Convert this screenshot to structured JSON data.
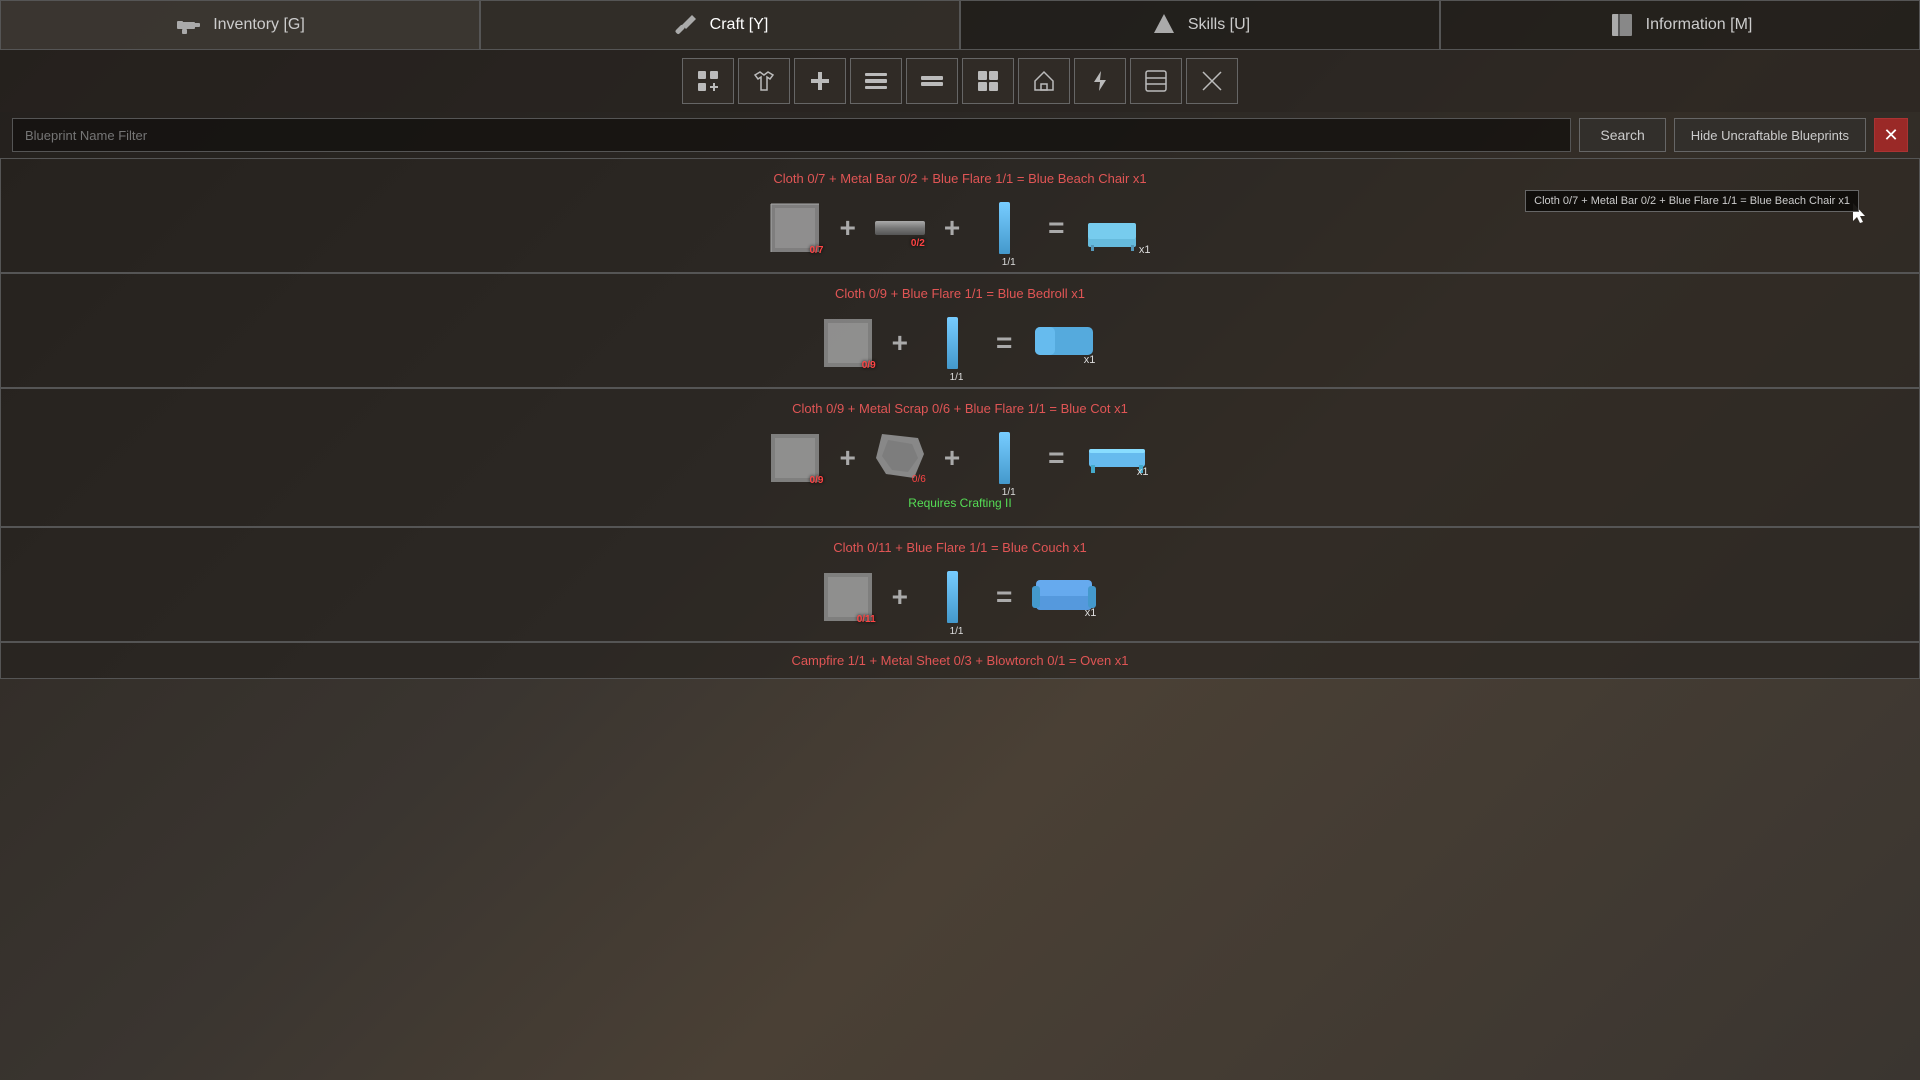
{
  "nav": {
    "items": [
      {
        "id": "inventory",
        "label": "Inventory [G]",
        "icon": "gun"
      },
      {
        "id": "craft",
        "label": "Craft [Y]",
        "icon": "wrench",
        "active": true
      },
      {
        "id": "skills",
        "label": "Skills [U]",
        "icon": "arrow-up"
      },
      {
        "id": "information",
        "label": "Information [M]",
        "icon": "book"
      }
    ]
  },
  "toolbar": {
    "buttons": [
      {
        "id": "all",
        "icon": "grid-plus",
        "symbol": "⊞₂"
      },
      {
        "id": "clothing",
        "icon": "shirt",
        "symbol": "👕"
      },
      {
        "id": "medical",
        "icon": "plus",
        "symbol": "+"
      },
      {
        "id": "tools",
        "icon": "tool",
        "symbol": "🔧"
      },
      {
        "id": "weapons",
        "icon": "equal",
        "symbol": "≡"
      },
      {
        "id": "ammo",
        "icon": "grid",
        "symbol": "⊞"
      },
      {
        "id": "building",
        "icon": "house",
        "symbol": "⌂"
      },
      {
        "id": "electric",
        "icon": "lightning",
        "symbol": "⚡"
      },
      {
        "id": "misc",
        "icon": "misc",
        "symbol": "⊟"
      },
      {
        "id": "wrench2",
        "icon": "wrench2",
        "symbol": "✕"
      }
    ]
  },
  "search": {
    "placeholder": "Blueprint Name Filter",
    "button_label": "Search",
    "hide_label": "Hide Uncraftable Blueprints"
  },
  "blueprints": [
    {
      "id": "blue-beach-chair",
      "title": "Cloth 0/7 + Metal Bar 0/2 + Blue Flare 1/1 = Blue Beach Chair x1",
      "ingredients": [
        {
          "name": "Cloth",
          "type": "cloth",
          "count": "0/7",
          "count_color": "red"
        },
        {
          "name": "Metal Bar",
          "type": "metalbar",
          "count": "0/2",
          "count_color": "red"
        },
        {
          "name": "Blue Flare",
          "type": "flare",
          "count": "1/1",
          "count_color": "white"
        }
      ],
      "result": {
        "name": "Blue Beach Chair",
        "type": "beach-chair",
        "count": "x1",
        "count_color": "white"
      },
      "tooltip": "Cloth 0/7 + Metal Bar 0/2 + Blue Flare 1/1 = Blue Beach Chair x1",
      "has_tooltip": true,
      "requires": ""
    },
    {
      "id": "blue-bedroll",
      "title": "Cloth 0/9 + Blue Flare 1/1 = Blue Bedroll x1",
      "ingredients": [
        {
          "name": "Cloth",
          "type": "cloth",
          "count": "0/9",
          "count_color": "red"
        },
        {
          "name": "Blue Flare",
          "type": "flare",
          "count": "1/1",
          "count_color": "white"
        }
      ],
      "result": {
        "name": "Blue Bedroll",
        "type": "bedroll",
        "count": "x1",
        "count_color": "white"
      },
      "has_tooltip": false,
      "requires": ""
    },
    {
      "id": "blue-cot",
      "title": "Cloth 0/9 + Metal Scrap 0/6 + Blue Flare 1/1 = Blue Cot x1",
      "ingredients": [
        {
          "name": "Cloth",
          "type": "cloth",
          "count": "0/9",
          "count_color": "red"
        },
        {
          "name": "Metal Scrap",
          "type": "metalscrap",
          "count": "0/6",
          "count_color": "red"
        },
        {
          "name": "Blue Flare",
          "type": "flare",
          "count": "1/1",
          "count_color": "white"
        }
      ],
      "result": {
        "name": "Blue Cot",
        "type": "cot",
        "count": "x1",
        "count_color": "white"
      },
      "has_tooltip": false,
      "requires": "Requires Crafting II"
    },
    {
      "id": "blue-couch",
      "title": "Cloth 0/11 + Blue Flare 1/1 = Blue Couch x1",
      "ingredients": [
        {
          "name": "Cloth",
          "type": "cloth",
          "count": "0/11",
          "count_color": "red"
        },
        {
          "name": "Blue Flare",
          "type": "flare",
          "count": "1/1",
          "count_color": "white"
        }
      ],
      "result": {
        "name": "Blue Couch",
        "type": "couch",
        "count": "x1",
        "count_color": "white"
      },
      "has_tooltip": false,
      "requires": ""
    }
  ],
  "bottom_card": {
    "title": "Campfire 1/1 + Metal Sheet 0/3 + Blowtorch 0/1 = Oven x1"
  }
}
